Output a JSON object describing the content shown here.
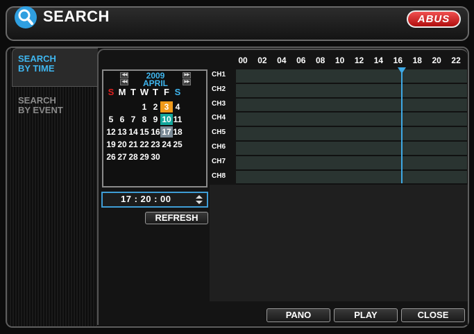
{
  "header": {
    "title": "SEARCH",
    "logo_text": "ABUS",
    "icon": "magnifier-icon"
  },
  "sidebar": {
    "tabs": [
      {
        "label": "SEARCH\nBY TIME",
        "active": true
      },
      {
        "label": "SEARCH\nBY EVENT",
        "active": false
      }
    ]
  },
  "calendar": {
    "year": "2009",
    "month": "APRIL",
    "weekdays": [
      "S",
      "M",
      "T",
      "W",
      "T",
      "F",
      "S"
    ],
    "weeks": [
      [
        "",
        "",
        "",
        "1",
        "2",
        "3",
        "4"
      ],
      [
        "5",
        "6",
        "7",
        "8",
        "9",
        "10",
        "11"
      ],
      [
        "12",
        "13",
        "14",
        "15",
        "16",
        "17",
        "18"
      ],
      [
        "19",
        "20",
        "21",
        "22",
        "23",
        "24",
        "25"
      ],
      [
        "26",
        "27",
        "28",
        "29",
        "30",
        "",
        ""
      ]
    ],
    "highlight_orange_day": "3",
    "highlight_teal_day": "10",
    "selected_day": "17"
  },
  "time_field": {
    "value": "17 : 20 : 00"
  },
  "buttons": {
    "refresh": "REFRESH",
    "pano": "PANO",
    "play": "PLAY",
    "close": "CLOSE"
  },
  "timeline": {
    "hours": [
      "00",
      "02",
      "04",
      "06",
      "08",
      "10",
      "12",
      "14",
      "16",
      "18",
      "20",
      "22"
    ],
    "channels": [
      "CH1",
      "CH2",
      "CH3",
      "CH4",
      "CH5",
      "CH6",
      "CH7",
      "CH8"
    ],
    "cursor_time": "17:20"
  },
  "colors": {
    "accent": "#3fb6ef",
    "weekday_sunday": "#e02020",
    "weekday_saturday": "#3fb6ef",
    "day_orange": "#f09a1a",
    "day_teal": "#13a79c",
    "day_selected": "#7a8a96",
    "channel_bar": "#2a3431",
    "logo_red": "#d82020"
  }
}
